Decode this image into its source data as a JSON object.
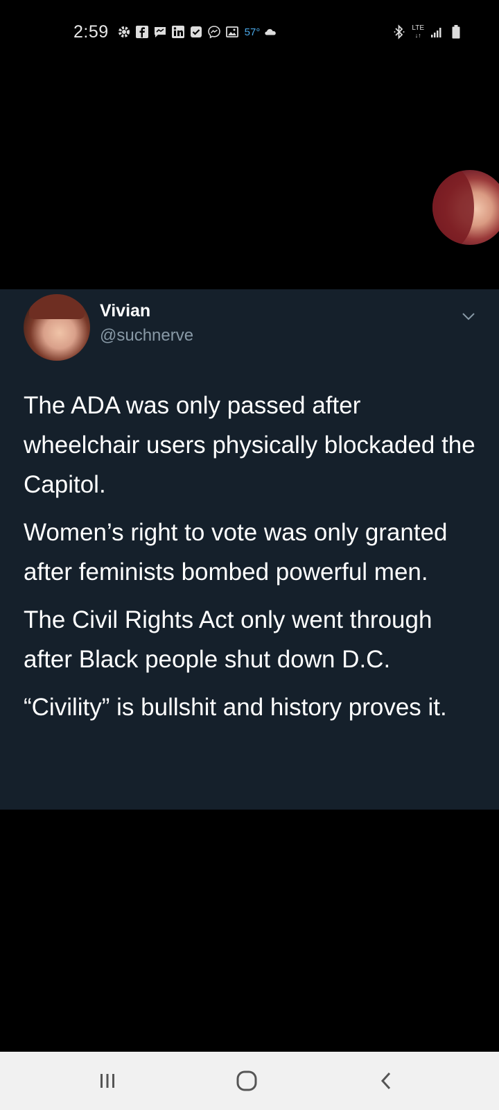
{
  "status_bar": {
    "time": "2:59",
    "temperature": "57°",
    "network": "LTE",
    "icons_left": [
      "settings-icon",
      "facebook-icon",
      "messages-icon",
      "linkedin-icon",
      "checkbox-icon",
      "messenger-icon",
      "gallery-icon",
      "cloud-icon"
    ],
    "icons_right": [
      "bluetooth-icon",
      "signal-icon",
      "battery-icon"
    ]
  },
  "tweet": {
    "author_name": "Vivian",
    "author_handle": "@suchnerve",
    "paragraphs": [
      "The ADA was only passed after wheelchair users physically blockaded the Capitol.",
      "Women’s right to vote was only granted after feminists bombed powerful men.",
      "The Civil Rights Act only went through after Black people shut down D.C.",
      "“Civility” is bullshit and history proves it."
    ]
  },
  "nav_bar": {
    "buttons": [
      "recent-apps",
      "home",
      "back"
    ]
  },
  "colors": {
    "tweet_background": "#15202b",
    "handle_gray": "#8899a6",
    "page_background": "#000000",
    "nav_background": "#f1f1f1"
  }
}
